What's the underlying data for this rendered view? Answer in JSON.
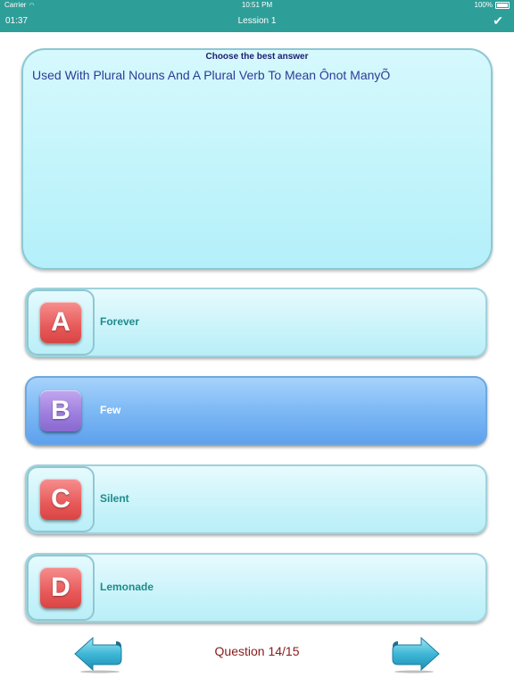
{
  "status_bar": {
    "carrier": "Carrier",
    "time": "10:51 PM",
    "battery": "100%"
  },
  "nav": {
    "timer": "01:37",
    "title": "Lession 1",
    "check_icon": "checkmark-icon"
  },
  "question": {
    "prompt": "Choose the best answer",
    "text": "Used With Plural Nouns And A Plural Verb To Mean Ônot ManyÕ"
  },
  "options": [
    {
      "letter": "A",
      "label": "Forever",
      "selected": false
    },
    {
      "letter": "B",
      "label": "Few",
      "selected": true
    },
    {
      "letter": "C",
      "label": "Silent",
      "selected": false
    },
    {
      "letter": "D",
      "label": "Lemonade",
      "selected": false
    }
  ],
  "footer": {
    "counter": "Question 14/15",
    "prev_icon": "left-arrow-icon",
    "next_icon": "right-arrow-icon"
  },
  "colors": {
    "bar": "#2e9e98",
    "option_letter": "#e85a5a",
    "selected_letter": "#9c7ddd",
    "selected_option": "#79b6f4",
    "label": "#1f8b8b",
    "counter": "#8b1a1a"
  }
}
